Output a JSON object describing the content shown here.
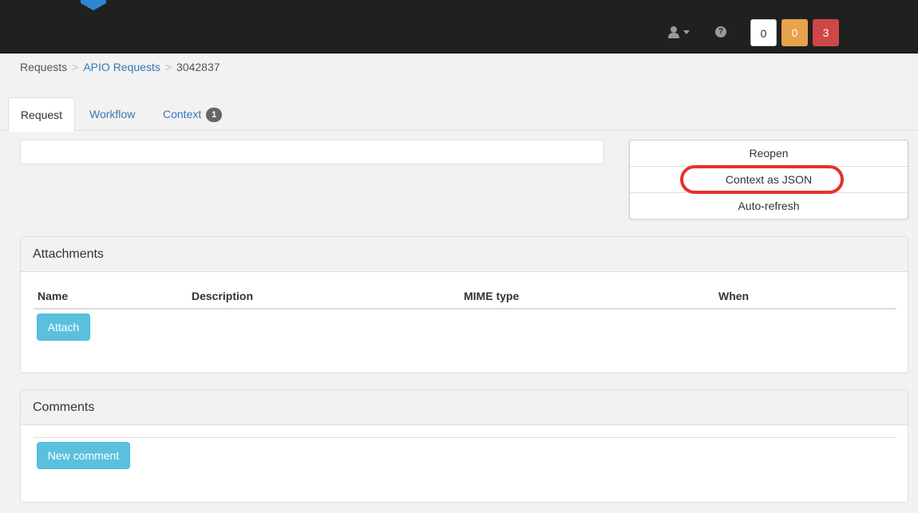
{
  "navbar": {
    "logo_icon": "hexagon-logo-icon",
    "user_icon": "user-icon",
    "user_caret_icon": "caret-down-icon",
    "help_icon": "question-circle-icon",
    "help_glyph": "?",
    "counters": [
      {
        "value": "0",
        "color": "#ffffff"
      },
      {
        "value": "0",
        "color": "#e8a24a"
      },
      {
        "value": "3",
        "color": "#cf4647"
      }
    ]
  },
  "breadcrumb": {
    "items": [
      "Requests",
      "APIO Requests",
      "3042837"
    ],
    "separator": ">"
  },
  "tabs": [
    {
      "label": "Request",
      "active": true
    },
    {
      "label": "Workflow",
      "active": false
    },
    {
      "label": "Context",
      "active": false,
      "badge": "1"
    }
  ],
  "title_field": {
    "value": ""
  },
  "actions": [
    {
      "label": "Reopen"
    },
    {
      "label": "Context as JSON",
      "highlighted": true
    },
    {
      "label": "Auto-refresh"
    }
  ],
  "attachments": {
    "title": "Attachments",
    "columns": [
      "Name",
      "Description",
      "MIME type",
      "When"
    ],
    "rows": [],
    "attach_label": "Attach"
  },
  "comments": {
    "title": "Comments",
    "new_comment_label": "New comment"
  },
  "colors": {
    "navbar_bg": "#202020",
    "link": "#337ab7",
    "info_button": "#5bc0de",
    "highlight_ring": "#e5322b"
  }
}
